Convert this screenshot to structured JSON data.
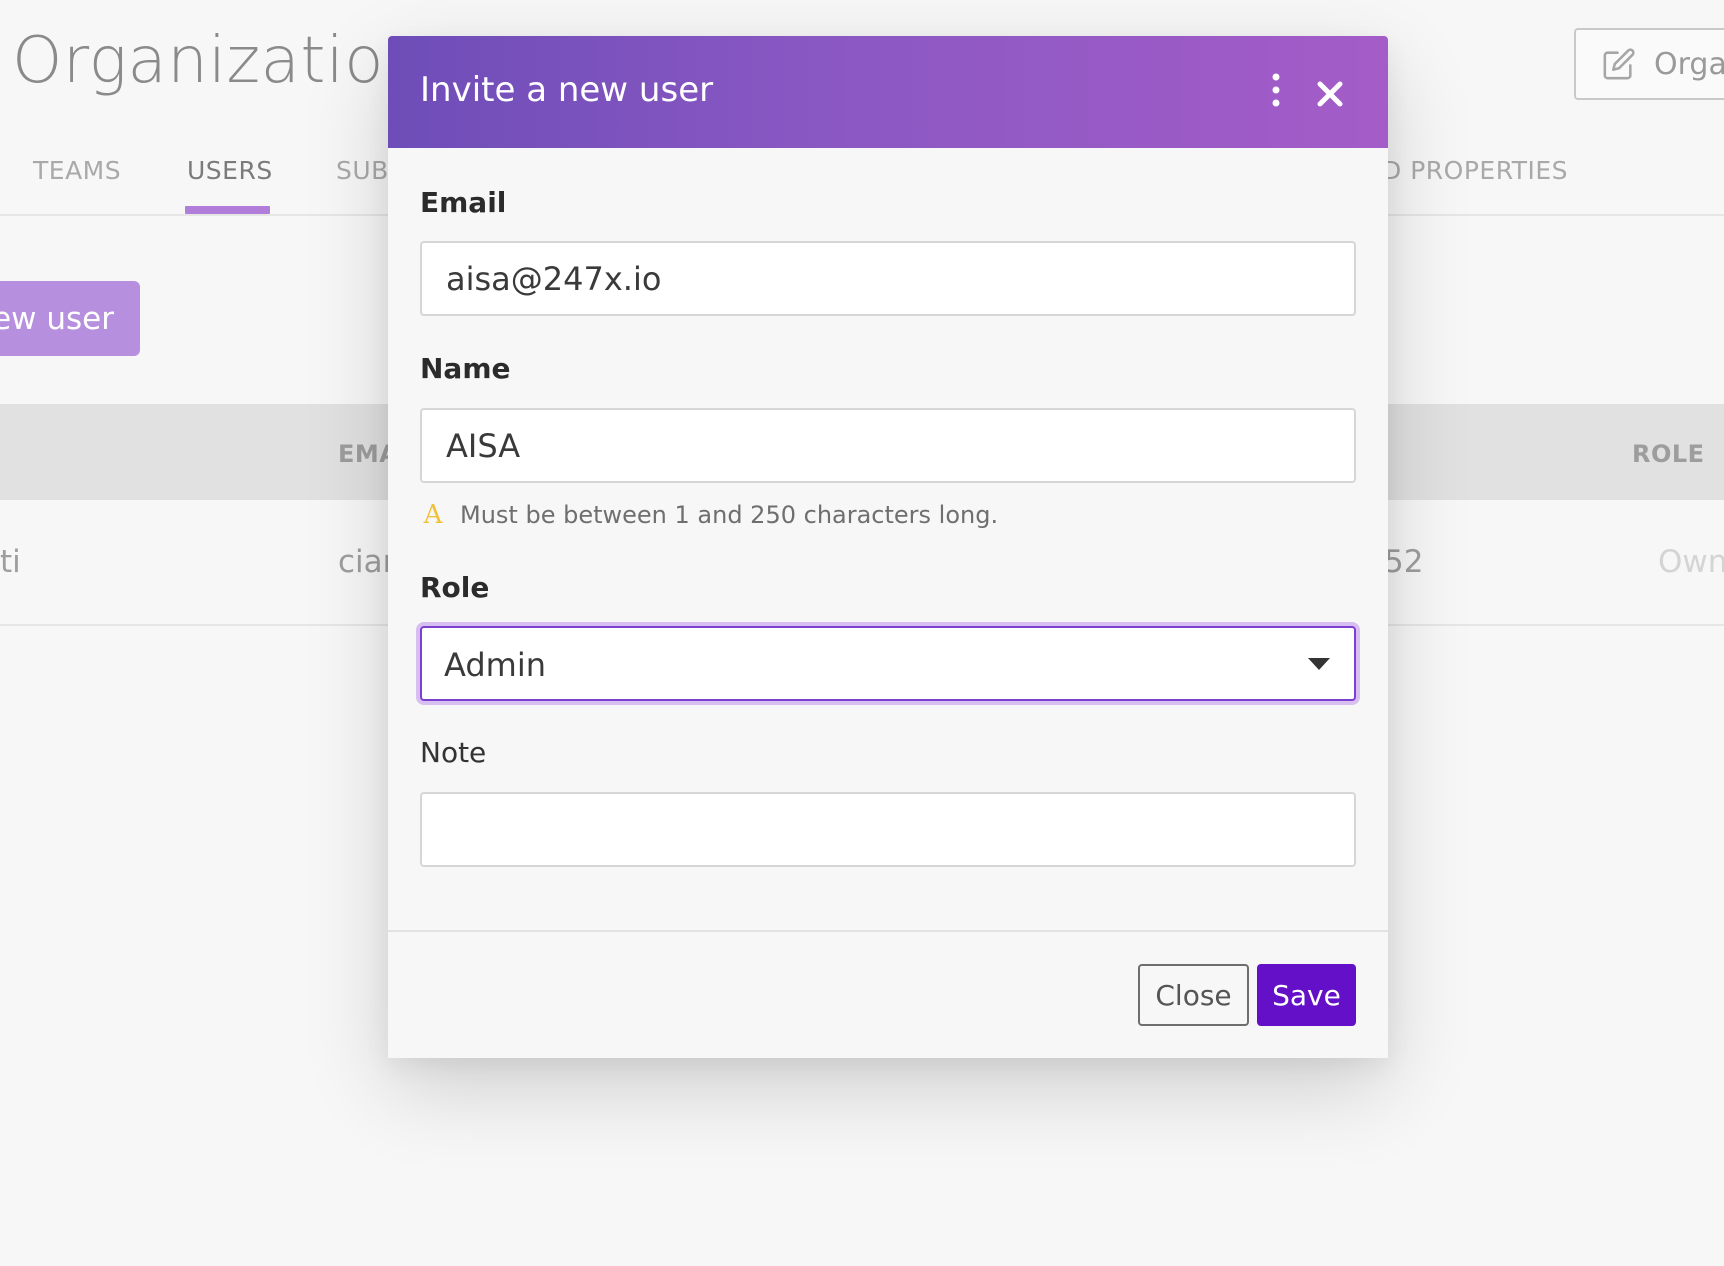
{
  "background": {
    "page_title": "Organization",
    "edit_button_label": "Orga",
    "tabs": [
      {
        "label": "TEAMS"
      },
      {
        "label": "USERS",
        "active": true
      },
      {
        "label": "SUB"
      },
      {
        "label": "D PROPERTIES"
      }
    ],
    "add_user_label": "ew user",
    "table": {
      "headers": [
        "EMA",
        "ROLE"
      ],
      "row": {
        "name": "ti",
        "email": "cian",
        "id": "52",
        "role": "Own"
      }
    }
  },
  "modal": {
    "title": "Invite a new user",
    "email_label": "Email",
    "email_value": "aisa@247x.io",
    "name_label": "Name",
    "name_value": "AISA",
    "name_validation": "Must be between 1 and 250 characters long.",
    "role_label": "Role",
    "role_value": "Admin",
    "note_label": "Note",
    "note_value": "",
    "close_label": "Close",
    "save_label": "Save"
  },
  "colors": {
    "header_gradient_start": "#6e4db8",
    "header_gradient_end": "#a45cc8",
    "primary": "#6410c8",
    "focus_ring": "#d7bff1",
    "warning": "#f0c23c",
    "tab_underline": "#b07ed8"
  },
  "icons": {
    "edit": "pencil-square-icon",
    "menu": "vertical-ellipsis-icon",
    "close": "close-icon",
    "warning": "warning-icon",
    "select": "caret-down-icon",
    "role_filter": "filter-icon"
  }
}
